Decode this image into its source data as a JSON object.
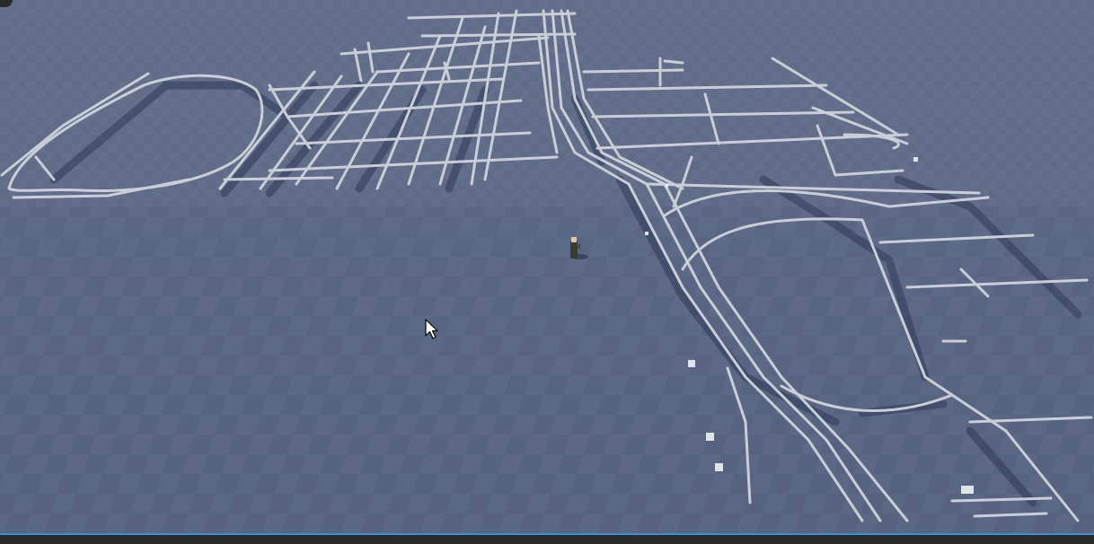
{
  "scene": {
    "ground": "baseplate-grid",
    "sky_color": "#6b7893",
    "ground_color": "#5a6682",
    "road_color": "#c9ced8",
    "road_shadow_color": "#2f3a58",
    "avatar": "player-character",
    "cursor": "mouse-pointer-icon"
  },
  "chrome": {
    "bottom_accent_color": "#3a8fd6"
  }
}
